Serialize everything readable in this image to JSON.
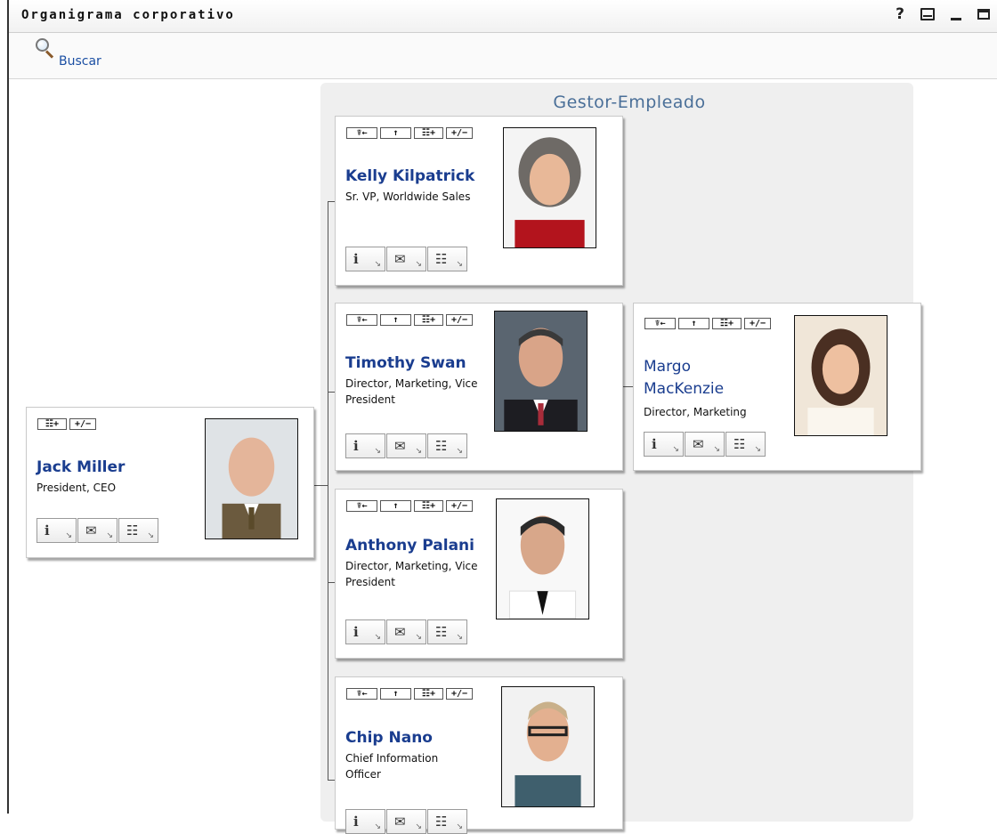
{
  "window": {
    "title": "Organigrama corporativo"
  },
  "toolbar": {
    "search_label": "Buscar"
  },
  "panel": {
    "title": "Gestor-Empleado"
  },
  "nav_buttons": {
    "up_to_manager": "☤←",
    "up": "↑",
    "expand": "☷+",
    "toggle": "+/−"
  },
  "action_icons": {
    "info": "ℹ",
    "email": "✉",
    "org": "☷"
  },
  "people": {
    "jack": {
      "name": "Jack Miller",
      "title": "President, CEO"
    },
    "kelly": {
      "name": "Kelly Kilpatrick",
      "title": "Sr. VP, Worldwide Sales"
    },
    "timothy": {
      "name": "Timothy Swan",
      "title": "Director, Marketing, Vice President"
    },
    "margo": {
      "name": "Margo MacKenzie",
      "title": "Director, Marketing"
    },
    "anthony": {
      "name": "Anthony Palani",
      "title": "Director, Marketing, Vice President"
    },
    "chip": {
      "name": "Chip Nano",
      "title": "Chief Information Officer"
    }
  },
  "colors": {
    "name_link": "#1a3d8f",
    "panel_title": "#4a6f98",
    "panel_bg": "#efefef"
  }
}
